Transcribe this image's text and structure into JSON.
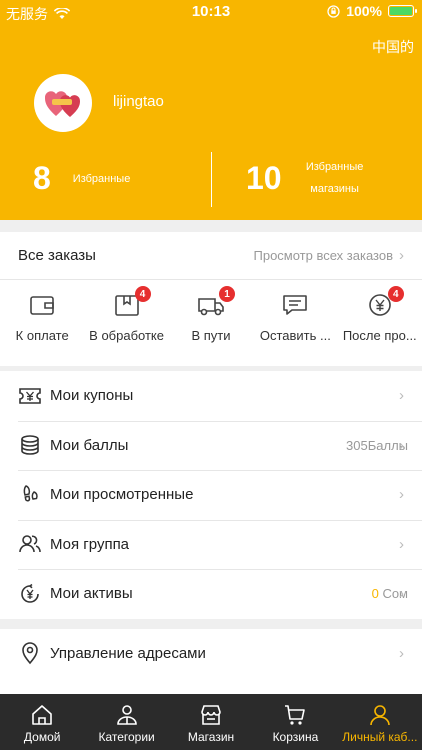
{
  "status_bar": {
    "carrier": "无服务",
    "time": "10:13",
    "battery": "100%"
  },
  "header": {
    "language": "中国的",
    "username": "lijingtao",
    "favorites_count": "8",
    "favorites_label": "Избранные",
    "shops_count": "10",
    "shops_label": "Избранные магазины",
    "accent_color": "#f8b600"
  },
  "orders": {
    "title": "Все заказы",
    "view_all": "Просмотр всех заказов",
    "tabs": [
      {
        "label": "К оплате",
        "icon": "wallet-icon",
        "badge": ""
      },
      {
        "label": "В обработке",
        "icon": "package-icon",
        "badge": "4"
      },
      {
        "label": "В пути",
        "icon": "truck-icon",
        "badge": "1"
      },
      {
        "label": "Оставить ...",
        "icon": "comment-icon",
        "badge": ""
      },
      {
        "label": "После про...",
        "icon": "yuan-refund-icon",
        "badge": "4"
      }
    ]
  },
  "menu": {
    "items": [
      {
        "label": "Мои купоны",
        "icon": "coupon-icon",
        "value": ""
      },
      {
        "label": "Мои баллы",
        "icon": "coins-icon",
        "value": "305Баллы"
      },
      {
        "label": "Мои просмотренные",
        "icon": "footprint-icon",
        "value": ""
      },
      {
        "label": "Моя группа",
        "icon": "group-icon",
        "value": ""
      },
      {
        "label": "Мои активы",
        "icon": "assets-icon",
        "value_amount": "0",
        "value_unit": "Сом"
      }
    ],
    "address_label": "Управление адресами"
  },
  "tabbar": {
    "items": [
      {
        "label": "Домой",
        "icon": "home-icon"
      },
      {
        "label": "Категории",
        "icon": "categories-icon"
      },
      {
        "label": "Магазин",
        "icon": "shop-icon"
      },
      {
        "label": "Корзина",
        "icon": "cart-icon"
      },
      {
        "label": "Личный каб...",
        "icon": "user-icon"
      }
    ],
    "active_index": 4
  }
}
